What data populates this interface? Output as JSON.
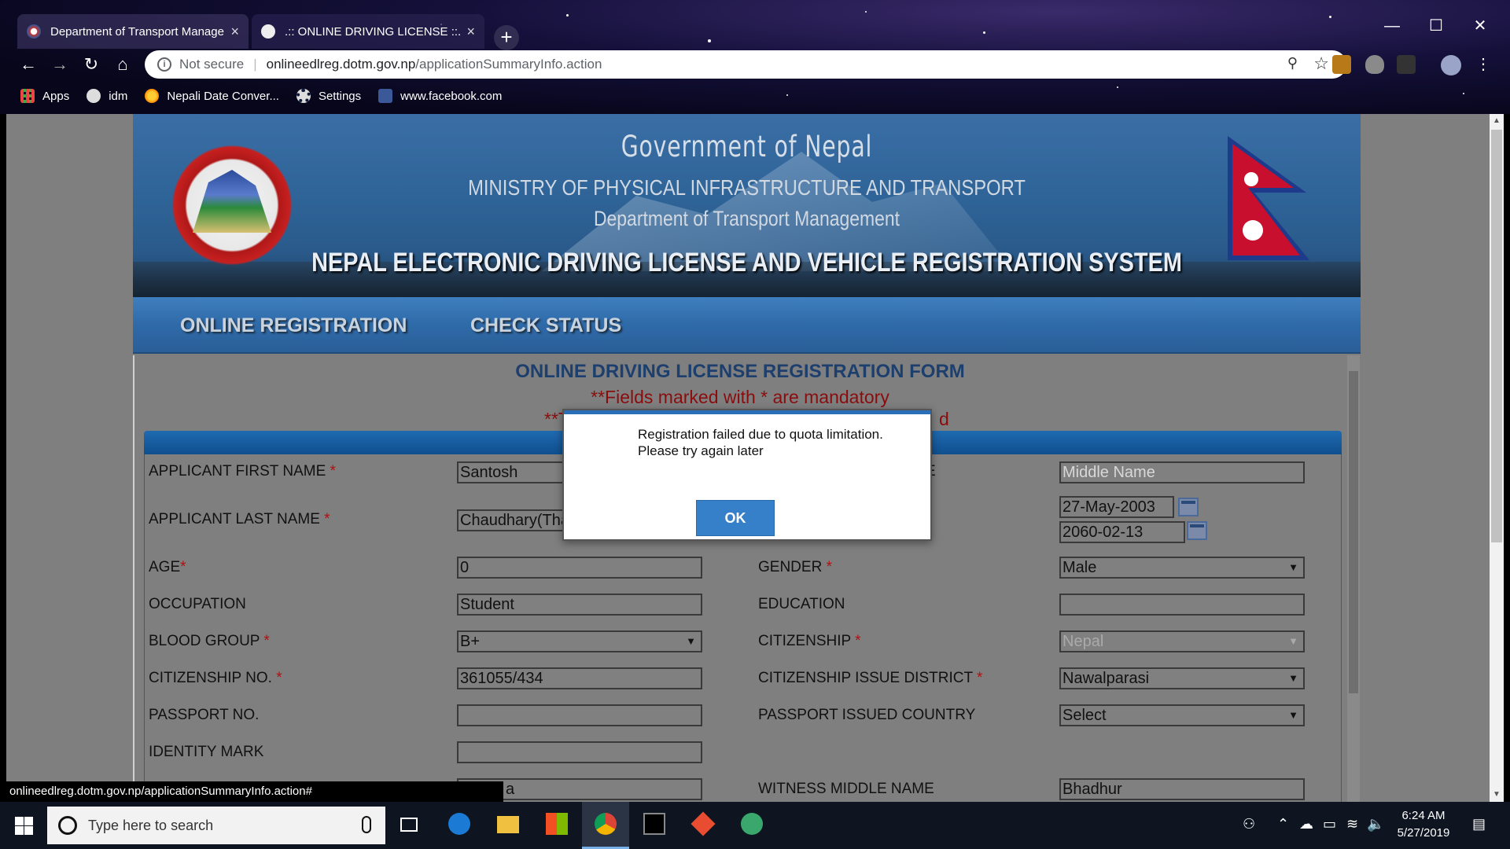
{
  "browser": {
    "tabs": [
      {
        "title": "Department of Transport Manage",
        "close": "×"
      },
      {
        "title": ".:: ONLINE DRIVING LICENSE ::.",
        "close": "×"
      }
    ],
    "new_tab": "+",
    "window_controls": {
      "minimize": "—",
      "maximize": "☐",
      "close": "✕"
    },
    "nav": {
      "back": "←",
      "forward": "→",
      "reload": "↻",
      "home": "⌂"
    },
    "address": {
      "security": "Not secure",
      "host": "onlineedlreg.dotm.gov.np",
      "path": "/applicationSummaryInfo.action"
    },
    "bookmarks": [
      {
        "label": "Apps",
        "icon": "apps-grid-icon"
      },
      {
        "label": "idm",
        "icon": "globe-icon"
      },
      {
        "label": "Nepali Date Conver...",
        "icon": "sun-icon"
      },
      {
        "label": "Settings",
        "icon": "gear-icon"
      },
      {
        "label": "www.facebook.com",
        "icon": "facebook-icon"
      }
    ],
    "status_url": "onlineedlreg.dotm.gov.np/applicationSummaryInfo.action#"
  },
  "banner": {
    "line1": "Government of Nepal",
    "line2": "MINISTRY OF PHYSICAL INFRASTRUCTURE AND TRANSPORT",
    "line3": "Department of Transport Management",
    "line4": "NEPAL ELECTRONIC DRIVING LICENSE AND VEHICLE REGISTRATION SYSTEM"
  },
  "nav": {
    "online_registration": "ONLINE REGISTRATION",
    "check_status": "CHECK STATUS"
  },
  "form": {
    "title": "ONLINE DRIVING LICENSE REGISTRATION FORM",
    "mandatory_note": "**Fields marked with * are mandatory",
    "note_start": "**T",
    "note_end": "d",
    "required_mark": "*",
    "labels": {
      "first_name": "APPLICANT FIRST NAME",
      "last_name": "APPLICANT LAST NAME",
      "age": "AGE",
      "occupation": "OCCUPATION",
      "blood_group": "BLOOD GROUP",
      "citizenship_no": "CITIZENSHIP NO.",
      "passport_no": "PASSPORT NO.",
      "identity_mark": "IDENTITY MARK",
      "middle_name_tail": "E",
      "gender": "GENDER",
      "education": "EDUCATION",
      "citizenship": "CITIZENSHIP",
      "citizenship_district": "CITIZENSHIP ISSUE DISTRICT",
      "passport_country": "PASSPORT ISSUED COUNTRY",
      "witness_middle_name": "WITNESS MIDDLE NAME"
    },
    "values": {
      "first_name": "Santosh",
      "last_name": "Chaudhary(Tha",
      "age": "0",
      "occupation": "Student",
      "blood_group": "B+",
      "citizenship_no": "361055/434",
      "passport_no": "",
      "identity_mark": "",
      "witness_first_tail": "a",
      "middle_name_placeholder": "Middle Name",
      "dob_ad": "27-May-2003",
      "dob_bs": "2060-02-13",
      "gender": "Male",
      "education": "",
      "citizenship": "Nepal",
      "citizenship_district": "Nawalparasi",
      "passport_country": "Select",
      "witness_middle_name": "Bhadhur"
    },
    "select_arrow": "▼"
  },
  "modal": {
    "message_line1": "Registration failed due to quota limitation.",
    "message_line2": "Please try again later",
    "ok": "OK"
  },
  "taskbar": {
    "search_placeholder": "Type here to search",
    "time": "6:24 AM",
    "date": "5/27/2019"
  }
}
